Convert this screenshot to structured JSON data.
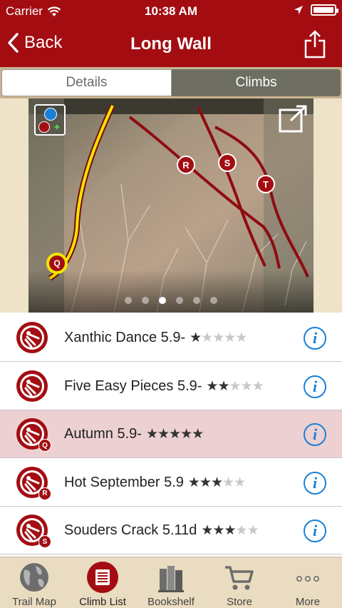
{
  "status_bar": {
    "carrier": "Carrier",
    "time": "10:38 AM",
    "battery_level": 1.0
  },
  "nav": {
    "back_label": "Back",
    "title": "Long Wall"
  },
  "segments": [
    {
      "label": "Details",
      "active": true
    },
    {
      "label": "Climbs",
      "active": false
    }
  ],
  "photo": {
    "route_markers": [
      "Q",
      "R",
      "S",
      "T"
    ],
    "pages": 6,
    "current_page": 3
  },
  "climbs": [
    {
      "name": "Xanthic Dance 5.9-",
      "stars": 1,
      "marker": "",
      "highlighted": false
    },
    {
      "name": "Five Easy Pieces 5.9-",
      "stars": 2,
      "marker": "",
      "highlighted": false
    },
    {
      "name": "Autumn 5.9-",
      "stars": 5,
      "marker": "Q",
      "highlighted": true
    },
    {
      "name": "Hot September 5.9",
      "stars": 3,
      "marker": "R",
      "highlighted": false
    },
    {
      "name": "Souders Crack 5.11d",
      "stars": 3,
      "marker": "S",
      "highlighted": false
    }
  ],
  "tabs": [
    {
      "label": "Trail Map",
      "icon": "globe-icon",
      "active": false
    },
    {
      "label": "Climb List",
      "icon": "list-icon",
      "active": true
    },
    {
      "label": "Bookshelf",
      "icon": "books-icon",
      "active": false
    },
    {
      "label": "Store",
      "icon": "cart-icon",
      "active": false
    },
    {
      "label": "More",
      "icon": "more-icon",
      "active": false
    }
  ],
  "colors": {
    "brand": "#a30d12",
    "highlight_row": "#ecd0d2",
    "info": "#1a7fd9",
    "tab_bar": "#eadcc0"
  }
}
